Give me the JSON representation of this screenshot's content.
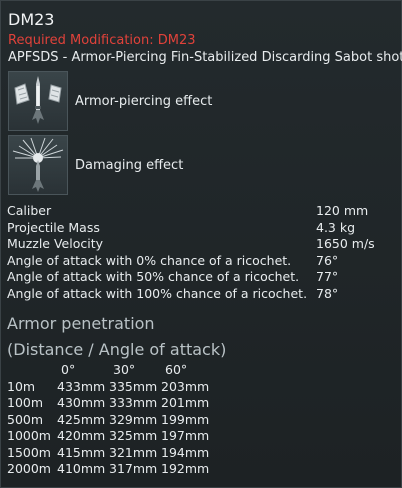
{
  "shell": {
    "name": "DM23",
    "required_prefix": "Required Modification: ",
    "required_mod": "DM23",
    "ammo_type": "APFSDS - Armor-Piercing Fin-Stabilized Discarding Sabot shot"
  },
  "effects": [
    {
      "label": "Armor-piercing effect",
      "icon": "armor-piercing-icon"
    },
    {
      "label": "Damaging effect",
      "icon": "damaging-effect-icon"
    }
  ],
  "stats": [
    {
      "label": "Caliber",
      "value": "120 mm"
    },
    {
      "label": "Projectile Mass",
      "value": "4.3 kg"
    },
    {
      "label": "Muzzle Velocity",
      "value": "1650 m/s"
    },
    {
      "label": "Angle of attack with 0% chance of a ricochet.",
      "value": "76°"
    },
    {
      "label": "Angle of attack with 50% chance of a ricochet.",
      "value": "77°"
    },
    {
      "label": "Angle of attack with 100% chance of a ricochet.",
      "value": "78°"
    }
  ],
  "penetration": {
    "title": "Armor penetration",
    "subtitle": "(Distance / Angle of attack)",
    "angles": [
      "0°",
      "30°",
      "60°"
    ],
    "rows": [
      {
        "distance": "10m",
        "values": [
          "433mm",
          "335mm",
          "203mm"
        ]
      },
      {
        "distance": "100m",
        "values": [
          "430mm",
          "333mm",
          "201mm"
        ]
      },
      {
        "distance": "500m",
        "values": [
          "425mm",
          "329mm",
          "199mm"
        ]
      },
      {
        "distance": "1000m",
        "values": [
          "420mm",
          "325mm",
          "197mm"
        ]
      },
      {
        "distance": "1500m",
        "values": [
          "415mm",
          "321mm",
          "194mm"
        ]
      },
      {
        "distance": "2000m",
        "values": [
          "410mm",
          "317mm",
          "192mm"
        ]
      }
    ]
  },
  "colors": {
    "background": "#1f2426",
    "text": "#e8ecee",
    "required": "#e0423a",
    "section_heading": "#b9c2c6"
  }
}
